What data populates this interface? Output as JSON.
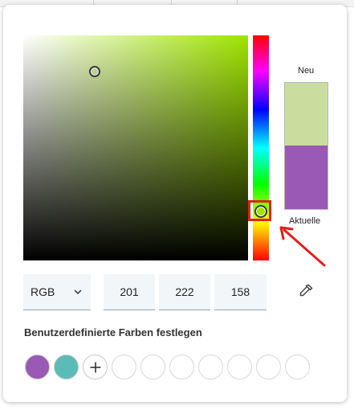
{
  "colors": {
    "hue": "#9fe400",
    "new_color": "#c9de9e",
    "current_color": "#9b59b6",
    "highlight": "#e0201c",
    "input_bg": "#f3f6f8",
    "accent_line": "#8aa6c1"
  },
  "preview": {
    "new_label": "Neu",
    "current_label": "Aktuelle"
  },
  "inputs": {
    "mode": "RGB",
    "mode_icon": "chevron-down-icon",
    "r": "201",
    "g": "222",
    "b": "158",
    "eyedropper_icon": "eyedropper-icon"
  },
  "custom_colors": {
    "title": "Benutzerdefinierte Farben festlegen",
    "swatches": [
      "#9b59b6",
      "#5bbcb7"
    ],
    "add_icon": "plus-icon",
    "empty_slots": 7
  },
  "annotation": {
    "arrow_icon": "arrow-icon"
  }
}
